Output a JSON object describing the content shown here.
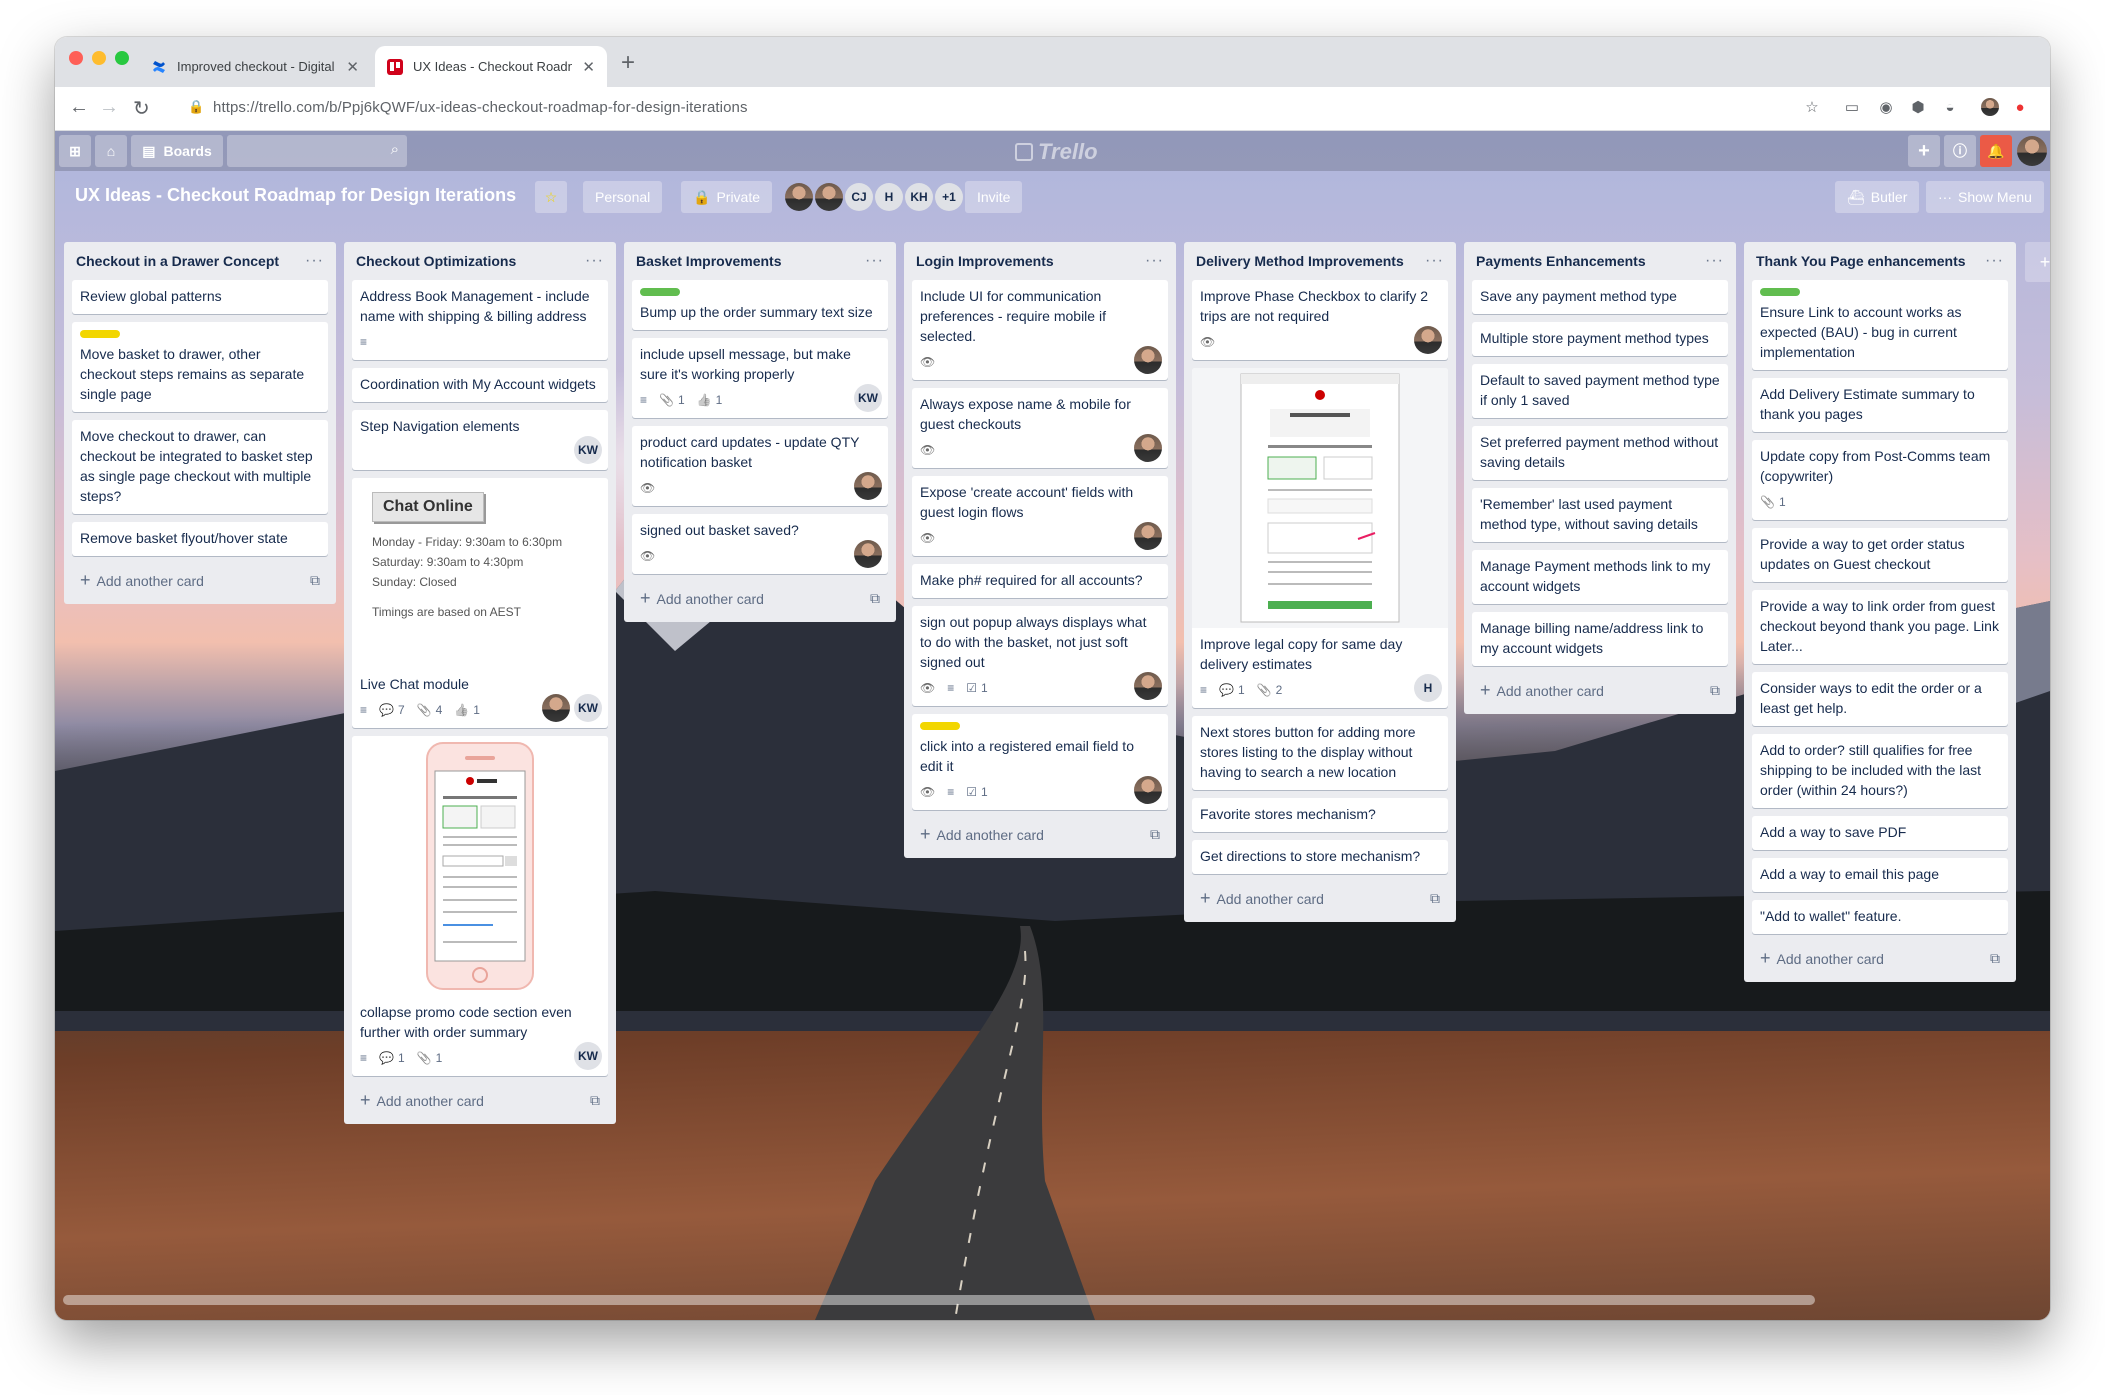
{
  "browser": {
    "tabs": [
      {
        "label": "Improved checkout - Digital Ex",
        "icon": "confluence-icon"
      },
      {
        "label": "UX Ideas - Checkout Roadmap",
        "icon": "trello-icon"
      }
    ],
    "new_tab": "+",
    "url": "https://trello.com/b/Ppj6kQWF/ux-ideas-checkout-roadmap-for-design-iterations"
  },
  "header": {
    "boards_label": "Boards",
    "logo_text": "Trello"
  },
  "board": {
    "title": "UX Ideas - Checkout Roadmap for Design Iterations",
    "visibility_team": "Personal",
    "visibility": "Private",
    "members": [
      "CJ",
      "H",
      "KH"
    ],
    "members_more": "+1",
    "invite_label": "Invite",
    "butler_label": "Butler",
    "menu_label": "Show Menu"
  },
  "colors": {
    "label_green": "#61bd4f",
    "label_yellow": "#f2d600",
    "notification": "#eb5a46"
  },
  "add_card_label": "Add another card",
  "lists": [
    {
      "name": "Checkout in a Drawer Concept",
      "cards": [
        {
          "text": "Review global patterns"
        },
        {
          "label": "yellow",
          "text": "Move basket to drawer, other checkout steps remains as separate single page"
        },
        {
          "text": "Move checkout to drawer, can checkout be integrated to basket step as single page checkout with multiple steps?"
        },
        {
          "text": "Remove basket flyout/hover state"
        }
      ]
    },
    {
      "name": "Checkout Optimizations",
      "cards": [
        {
          "text": "Address Book Management - include name with shipping & billing address",
          "desc": true
        },
        {
          "text": "Coordination with My Account widgets"
        },
        {
          "text": "Step Navigation elements",
          "members": [
            "KW"
          ]
        },
        {
          "cover": "chat",
          "chat": {
            "button": "Chat Online",
            "hours": [
              "Monday - Friday: 9:30am to 6:30pm",
              "Saturday: 9:30am to 4:30pm",
              "Sunday: Closed"
            ],
            "note": "Timings are based on AEST"
          },
          "text": "Live Chat module",
          "desc": true,
          "comments": "7",
          "attachments": "4",
          "votes": "1",
          "members": [
            "avatar",
            "KW"
          ]
        },
        {
          "cover": "phone",
          "text": "collapse promo code section even further with order summary",
          "desc": true,
          "comments": "1",
          "attachments": "1",
          "members": [
            "KW"
          ]
        }
      ]
    },
    {
      "name": "Basket Improvements",
      "cards": [
        {
          "label": "green",
          "text": "Bump up the order summary text size"
        },
        {
          "text": "include upsell message, but make sure it's working properly",
          "desc": true,
          "attachments": "1",
          "votes": "1",
          "members": [
            "KW"
          ]
        },
        {
          "text": "product card updates - update QTY notification basket",
          "watch": true,
          "members": [
            "avatar"
          ]
        },
        {
          "text": "signed out basket saved?",
          "watch": true,
          "members": [
            "avatar"
          ]
        }
      ]
    },
    {
      "name": "Login Improvements",
      "cards": [
        {
          "text": "Include UI for communication preferences - require mobile if selected.",
          "watch": true,
          "members": [
            "avatar"
          ]
        },
        {
          "text": "Always expose name & mobile for guest checkouts",
          "watch": true,
          "members": [
            "avatar"
          ]
        },
        {
          "text": "Expose 'create account' fields with guest login flows",
          "watch": true,
          "members": [
            "avatar"
          ]
        },
        {
          "text": "Make ph# required for all accounts?"
        },
        {
          "text": "sign out popup always displays what to do with the basket, not just soft signed out",
          "watch": true,
          "desc": true,
          "checklist": "1",
          "members": [
            "avatar"
          ]
        },
        {
          "label": "yellow",
          "text": "click into a registered email field to edit it",
          "watch": true,
          "desc": true,
          "checklist": "1",
          "members": [
            "avatar"
          ]
        }
      ]
    },
    {
      "name": "Delivery Method Improvements",
      "cards": [
        {
          "text": "Improve Phase Checkbox to clarify 2 trips are not required",
          "watch": true,
          "members": [
            "avatar"
          ]
        },
        {
          "cover": "screenshot",
          "text": "Improve legal copy for same day delivery estimates",
          "desc": true,
          "comments": "1",
          "attachments": "2",
          "members": [
            "H"
          ]
        },
        {
          "text": "Next stores button for adding more stores listing to the display without having to search a new location"
        },
        {
          "text": "Favorite stores mechanism?"
        },
        {
          "text": "Get directions to store mechanism?"
        }
      ]
    },
    {
      "name": "Payments Enhancements",
      "cards": [
        {
          "text": "Save any payment method type"
        },
        {
          "text": "Multiple store payment method types"
        },
        {
          "text": "Default to saved payment method type if only 1 saved"
        },
        {
          "text": "Set preferred payment method without saving details"
        },
        {
          "text": "'Remember' last used payment method type, without saving details"
        },
        {
          "text": "Manage Payment methods link to my account widgets"
        },
        {
          "text": "Manage billing name/address link to my account widgets"
        }
      ]
    },
    {
      "name": "Thank You Page enhancements",
      "cards": [
        {
          "label": "green",
          "text": "Ensure Link to account works as expected (BAU) - bug in current implementation"
        },
        {
          "text": "Add Delivery Estimate summary to thank you pages"
        },
        {
          "text": "Update copy from Post-Comms team (copywriter)",
          "attachments": "1"
        },
        {
          "text": "Provide a way to get order status updates on Guest checkout"
        },
        {
          "text": "Provide a way to link order from guest checkout beyond thank you page. Link Later..."
        },
        {
          "text": "Consider ways to edit the order or a least get help."
        },
        {
          "text": "Add to order? still qualifies for free shipping to be included with the last order (within 24 hours?)"
        },
        {
          "text": "Add a way to save PDF"
        },
        {
          "text": "Add a way to email this page"
        },
        {
          "text": "\"Add to wallet\" feature."
        }
      ]
    }
  ]
}
